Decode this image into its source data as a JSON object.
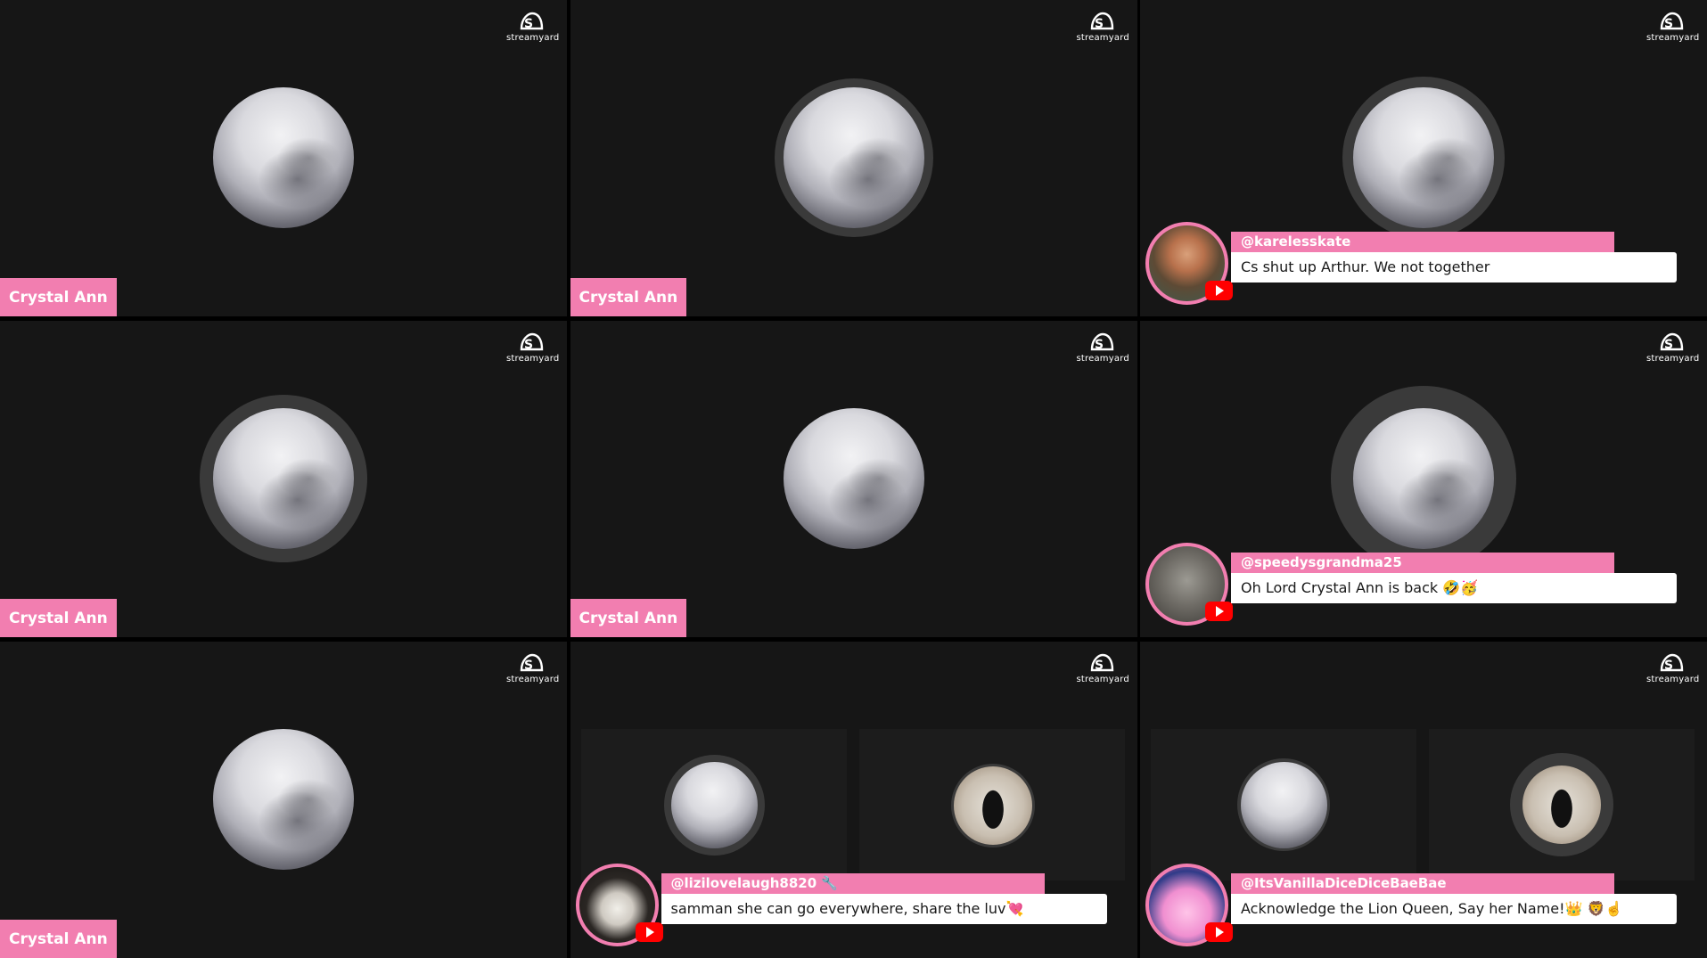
{
  "brand": {
    "logo_text": "streamyard"
  },
  "tiles": [
    {
      "name_tag": "Crystal Ann"
    },
    {
      "name_tag": "Crystal Ann"
    },
    {
      "chat": {
        "user": "@karelesskate",
        "message": "Cs shut up Arthur. We not together"
      }
    },
    {
      "name_tag": "Crystal Ann"
    },
    {
      "name_tag": "Crystal Ann"
    },
    {
      "chat": {
        "user": "@speedysgrandma25",
        "message": "Oh Lord Crystal Ann is back 🤣🥳"
      }
    },
    {
      "name_tag": "Crystal Ann"
    },
    {
      "chat": {
        "user": "@lizilovelaugh8820 🔧",
        "message": "samman she can go everywhere, share the luv💘"
      }
    },
    {
      "chat": {
        "user": "@ItsVanillaDiceDiceBaeBae",
        "message": "Acknowledge the Lion Queen, Say her Name!👑 🦁☝️"
      }
    }
  ],
  "colors": {
    "accent": "#f27eb0",
    "tile_bg": "#161616",
    "youtube_red": "#ff0000"
  }
}
